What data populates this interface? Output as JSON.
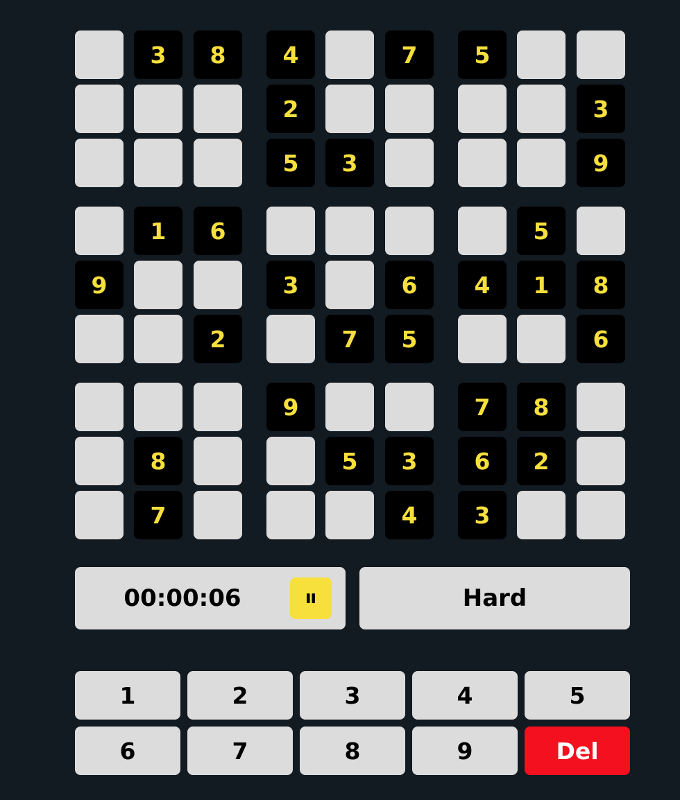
{
  "board": {
    "grid": [
      [
        "",
        "3",
        "8",
        "4",
        "",
        "7",
        "5",
        "",
        ""
      ],
      [
        "",
        "",
        "",
        "2",
        "",
        "",
        "",
        "",
        "3"
      ],
      [
        "",
        "",
        "",
        "5",
        "3",
        "",
        "",
        "",
        "9"
      ],
      [
        "",
        "1",
        "6",
        "",
        "",
        "",
        "",
        "5",
        ""
      ],
      [
        "9",
        "",
        "",
        "3",
        "",
        "6",
        "4",
        "1",
        "8"
      ],
      [
        "",
        "",
        "2",
        "",
        "7",
        "5",
        "",
        "",
        "6"
      ],
      [
        "",
        "",
        "",
        "9",
        "",
        "",
        "7",
        "8",
        ""
      ],
      [
        "",
        "8",
        "",
        "",
        "5",
        "3",
        "6",
        "2",
        ""
      ],
      [
        "",
        "7",
        "",
        "",
        "",
        "4",
        "3",
        "",
        ""
      ]
    ]
  },
  "timer": {
    "time": "00:00:06",
    "pause_icon": "pause-icon"
  },
  "difficulty": {
    "label": "Hard"
  },
  "keypad": {
    "keys": [
      "1",
      "2",
      "3",
      "4",
      "5",
      "6",
      "7",
      "8",
      "9",
      "Del"
    ]
  },
  "colors": {
    "background": "#121a22",
    "given_cell": "#000000",
    "given_digit": "#f7e03c",
    "empty_cell": "#dcdcdc",
    "accent": "#f7e03c",
    "delete": "#f5101f"
  }
}
